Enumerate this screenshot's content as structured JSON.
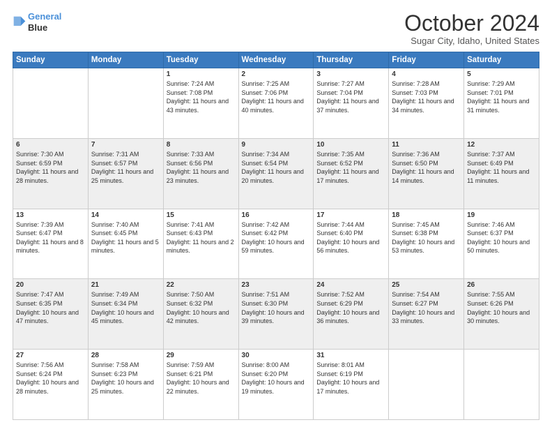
{
  "header": {
    "logo_line1": "General",
    "logo_line2": "Blue",
    "month": "October 2024",
    "location": "Sugar City, Idaho, United States"
  },
  "weekdays": [
    "Sunday",
    "Monday",
    "Tuesday",
    "Wednesday",
    "Thursday",
    "Friday",
    "Saturday"
  ],
  "weeks": [
    [
      {
        "day": "",
        "info": ""
      },
      {
        "day": "",
        "info": ""
      },
      {
        "day": "1",
        "info": "Sunrise: 7:24 AM\nSunset: 7:08 PM\nDaylight: 11 hours and 43 minutes."
      },
      {
        "day": "2",
        "info": "Sunrise: 7:25 AM\nSunset: 7:06 PM\nDaylight: 11 hours and 40 minutes."
      },
      {
        "day": "3",
        "info": "Sunrise: 7:27 AM\nSunset: 7:04 PM\nDaylight: 11 hours and 37 minutes."
      },
      {
        "day": "4",
        "info": "Sunrise: 7:28 AM\nSunset: 7:03 PM\nDaylight: 11 hours and 34 minutes."
      },
      {
        "day": "5",
        "info": "Sunrise: 7:29 AM\nSunset: 7:01 PM\nDaylight: 11 hours and 31 minutes."
      }
    ],
    [
      {
        "day": "6",
        "info": "Sunrise: 7:30 AM\nSunset: 6:59 PM\nDaylight: 11 hours and 28 minutes."
      },
      {
        "day": "7",
        "info": "Sunrise: 7:31 AM\nSunset: 6:57 PM\nDaylight: 11 hours and 25 minutes."
      },
      {
        "day": "8",
        "info": "Sunrise: 7:33 AM\nSunset: 6:56 PM\nDaylight: 11 hours and 23 minutes."
      },
      {
        "day": "9",
        "info": "Sunrise: 7:34 AM\nSunset: 6:54 PM\nDaylight: 11 hours and 20 minutes."
      },
      {
        "day": "10",
        "info": "Sunrise: 7:35 AM\nSunset: 6:52 PM\nDaylight: 11 hours and 17 minutes."
      },
      {
        "day": "11",
        "info": "Sunrise: 7:36 AM\nSunset: 6:50 PM\nDaylight: 11 hours and 14 minutes."
      },
      {
        "day": "12",
        "info": "Sunrise: 7:37 AM\nSunset: 6:49 PM\nDaylight: 11 hours and 11 minutes."
      }
    ],
    [
      {
        "day": "13",
        "info": "Sunrise: 7:39 AM\nSunset: 6:47 PM\nDaylight: 11 hours and 8 minutes."
      },
      {
        "day": "14",
        "info": "Sunrise: 7:40 AM\nSunset: 6:45 PM\nDaylight: 11 hours and 5 minutes."
      },
      {
        "day": "15",
        "info": "Sunrise: 7:41 AM\nSunset: 6:43 PM\nDaylight: 11 hours and 2 minutes."
      },
      {
        "day": "16",
        "info": "Sunrise: 7:42 AM\nSunset: 6:42 PM\nDaylight: 10 hours and 59 minutes."
      },
      {
        "day": "17",
        "info": "Sunrise: 7:44 AM\nSunset: 6:40 PM\nDaylight: 10 hours and 56 minutes."
      },
      {
        "day": "18",
        "info": "Sunrise: 7:45 AM\nSunset: 6:38 PM\nDaylight: 10 hours and 53 minutes."
      },
      {
        "day": "19",
        "info": "Sunrise: 7:46 AM\nSunset: 6:37 PM\nDaylight: 10 hours and 50 minutes."
      }
    ],
    [
      {
        "day": "20",
        "info": "Sunrise: 7:47 AM\nSunset: 6:35 PM\nDaylight: 10 hours and 47 minutes."
      },
      {
        "day": "21",
        "info": "Sunrise: 7:49 AM\nSunset: 6:34 PM\nDaylight: 10 hours and 45 minutes."
      },
      {
        "day": "22",
        "info": "Sunrise: 7:50 AM\nSunset: 6:32 PM\nDaylight: 10 hours and 42 minutes."
      },
      {
        "day": "23",
        "info": "Sunrise: 7:51 AM\nSunset: 6:30 PM\nDaylight: 10 hours and 39 minutes."
      },
      {
        "day": "24",
        "info": "Sunrise: 7:52 AM\nSunset: 6:29 PM\nDaylight: 10 hours and 36 minutes."
      },
      {
        "day": "25",
        "info": "Sunrise: 7:54 AM\nSunset: 6:27 PM\nDaylight: 10 hours and 33 minutes."
      },
      {
        "day": "26",
        "info": "Sunrise: 7:55 AM\nSunset: 6:26 PM\nDaylight: 10 hours and 30 minutes."
      }
    ],
    [
      {
        "day": "27",
        "info": "Sunrise: 7:56 AM\nSunset: 6:24 PM\nDaylight: 10 hours and 28 minutes."
      },
      {
        "day": "28",
        "info": "Sunrise: 7:58 AM\nSunset: 6:23 PM\nDaylight: 10 hours and 25 minutes."
      },
      {
        "day": "29",
        "info": "Sunrise: 7:59 AM\nSunset: 6:21 PM\nDaylight: 10 hours and 22 minutes."
      },
      {
        "day": "30",
        "info": "Sunrise: 8:00 AM\nSunset: 6:20 PM\nDaylight: 10 hours and 19 minutes."
      },
      {
        "day": "31",
        "info": "Sunrise: 8:01 AM\nSunset: 6:19 PM\nDaylight: 10 hours and 17 minutes."
      },
      {
        "day": "",
        "info": ""
      },
      {
        "day": "",
        "info": ""
      }
    ]
  ]
}
